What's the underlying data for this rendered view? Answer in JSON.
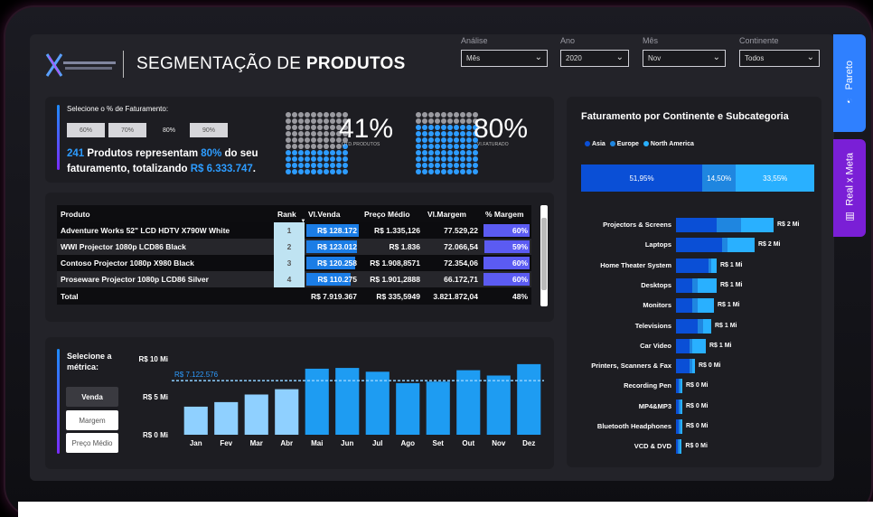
{
  "header": {
    "title_prefix": "SEGMENTAÇÃO DE ",
    "title_bold": "PRODUTOS"
  },
  "filters": [
    {
      "label": "Análise",
      "value": "Mês"
    },
    {
      "label": "Ano",
      "value": "2020"
    },
    {
      "label": "Mês",
      "value": "Nov"
    },
    {
      "label": "Continente",
      "value": "Todos"
    }
  ],
  "side_tabs": [
    {
      "label": "Pareto"
    },
    {
      "label": "Real x Meta"
    }
  ],
  "percent_selector": {
    "prompt": "Selecione o % de Faturamento:",
    "options": [
      "60%",
      "70%",
      "80%",
      "90%"
    ],
    "selected": "80%"
  },
  "summary": {
    "count": "241",
    "text1": " Produtos representam ",
    "pct": "80%",
    "text2": " do seu faturamento, totalizando ",
    "total": "R$ 6.333.747",
    "text3": "."
  },
  "kpis": [
    {
      "value": "41%",
      "caption": "QTD.PRODUTOS",
      "fraction": 0.41
    },
    {
      "value": "80%",
      "caption": "Vl.FATURADO",
      "fraction": 0.8
    }
  ],
  "colors": {
    "accent_blue": "#2d9cff",
    "bar_blue": "#1b7de6",
    "margin_purple": "#5b5bf2",
    "asia": "#0a4fd6",
    "europe": "#1f86e0",
    "north_america": "#29b0ff"
  },
  "table": {
    "headers": [
      "Produto",
      "Rank",
      "Vl.Venda",
      "Preço Médio",
      "Vl.Margem",
      "% Margem"
    ],
    "rows": [
      {
        "produto": "Adventure Works 52\" LCD HDTV X790W White",
        "rank": "1",
        "venda": "R$ 128.172",
        "preco": "R$ 1.335,126",
        "margem": "77.529,22",
        "pct": "60%",
        "venda_frac": 1.0,
        "pct_frac": 0.6
      },
      {
        "produto": "WWI Projector 1080p LCD86 Black",
        "rank": "2",
        "venda": "R$ 123.012",
        "preco": "R$ 1.836",
        "margem": "72.066,54",
        "pct": "59%",
        "venda_frac": 0.96,
        "pct_frac": 0.59
      },
      {
        "produto": "Contoso Projector 1080p X980 Black",
        "rank": "3",
        "venda": "R$ 120.258",
        "preco": "R$ 1.908,8571",
        "margem": "72.354,06",
        "pct": "60%",
        "venda_frac": 0.94,
        "pct_frac": 0.6
      },
      {
        "produto": "Proseware Projector 1080p LCD86 Silver",
        "rank": "4",
        "venda": "R$ 110.275",
        "preco": "R$ 1.901,2888",
        "margem": "66.172,71",
        "pct": "60%",
        "venda_frac": 0.86,
        "pct_frac": 0.6
      }
    ],
    "total": {
      "label": "Total",
      "venda": "R$ 7.919.367",
      "preco": "R$ 335,5949",
      "margem": "3.821.872,04",
      "pct": "48%"
    }
  },
  "metric_selector": {
    "prompt": "Selecione a métrica:",
    "options": [
      "Venda",
      "Margem",
      "Preço Médio"
    ],
    "selected": "Venda"
  },
  "chart_data": [
    {
      "type": "bar",
      "categories": [
        "Jan",
        "Fev",
        "Mar",
        "Abr",
        "Mai",
        "Jun",
        "Jul",
        "Ago",
        "Set",
        "Out",
        "Nov",
        "Dez"
      ],
      "values": [
        3.7,
        4.3,
        5.3,
        6.0,
        8.7,
        8.8,
        8.3,
        6.8,
        7.0,
        8.5,
        7.8,
        9.3
      ],
      "highlight": [
        "Jan",
        "Fev",
        "Mar",
        "Abr"
      ],
      "yticks": [
        "R$ 10 Mi",
        "R$ 5 Mi",
        "R$ 0 Mi"
      ],
      "ylim": [
        0,
        10
      ],
      "reference_line": {
        "value": 7.122576,
        "label": "R$ 7.122.576"
      },
      "grid": false
    },
    {
      "type": "bar",
      "title": "Faturamento por Continente e Subcategoria",
      "legend": [
        "Asia",
        "Europe",
        "North America"
      ],
      "stacked_share": [
        {
          "name": "Asia",
          "value": 51.95,
          "label": "51,95%"
        },
        {
          "name": "Europe",
          "value": 14.5,
          "label": "14,50%"
        },
        {
          "name": "North America",
          "value": 33.55,
          "label": "33,55%"
        }
      ],
      "categories": [
        {
          "name": "Projectors & Screens",
          "label": "R$ 2 Mi",
          "values": [
            0.75,
            0.45,
            0.6
          ]
        },
        {
          "name": "Laptops",
          "label": "R$ 2 Mi",
          "values": [
            0.85,
            0.1,
            0.5
          ]
        },
        {
          "name": "Home Theater System",
          "label": "R$ 1 Mi",
          "values": [
            0.6,
            0.05,
            0.1
          ]
        },
        {
          "name": "Desktops",
          "label": "R$ 1 Mi",
          "values": [
            0.3,
            0.1,
            0.35
          ]
        },
        {
          "name": "Monitors",
          "label": "R$ 1 Mi",
          "values": [
            0.3,
            0.1,
            0.3
          ]
        },
        {
          "name": "Televisions",
          "label": "R$ 1 Mi",
          "values": [
            0.4,
            0.1,
            0.15
          ]
        },
        {
          "name": "Car Video",
          "label": "R$ 1 Mi",
          "values": [
            0.25,
            0.05,
            0.25
          ]
        },
        {
          "name": "Printers, Scanners & Fax",
          "label": "R$ 0 Mi",
          "values": [
            0.25,
            0.05,
            0.05
          ]
        },
        {
          "name": "Recording Pen",
          "label": "R$ 0 Mi",
          "values": [
            0.05,
            0.02,
            0.02
          ]
        },
        {
          "name": "MP4&MP3",
          "label": "R$ 0 Mi",
          "values": [
            0.05,
            0.02,
            0.02
          ]
        },
        {
          "name": "Bluetooth Headphones",
          "label": "R$ 0 Mi",
          "values": [
            0.05,
            0.02,
            0.02
          ]
        },
        {
          "name": "VCD & DVD",
          "label": "R$ 0 Mi",
          "values": [
            0.04,
            0.01,
            0.01
          ]
        }
      ]
    }
  ]
}
